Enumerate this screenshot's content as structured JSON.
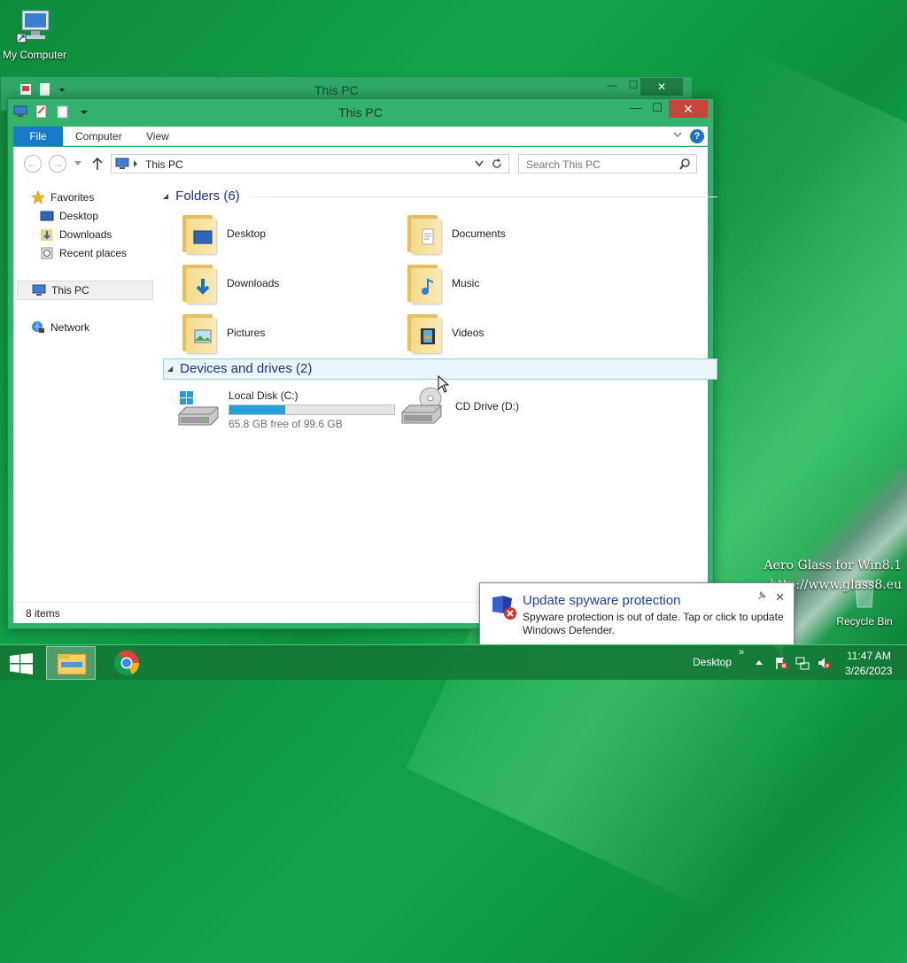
{
  "desktop": {
    "my_computer_label": "My Computer",
    "recycle_bin_label": "Recycle Bin",
    "watermark_line1": "Aero Glass for Win8.1",
    "watermark_line2": "http://www.glass8.eu"
  },
  "background_window": {
    "title": "This PC"
  },
  "window": {
    "title": "This PC",
    "controls": {
      "minimize": "—",
      "maximize": "☐",
      "close": "✕"
    },
    "ribbon_tabs": [
      "File",
      "Computer",
      "View"
    ],
    "help_glyph": "?",
    "address_path": "This PC",
    "search_placeholder": "Search This PC",
    "nav_pane": {
      "favorites_label": "Favorites",
      "favorites": [
        "Desktop",
        "Downloads",
        "Recent places"
      ],
      "this_pc_label": "This PC",
      "network_label": "Network"
    },
    "folders_header": "Folders (6)",
    "folders": [
      {
        "label": "Desktop",
        "icon": "desktop-folder-icon"
      },
      {
        "label": "Documents",
        "icon": "documents-folder-icon"
      },
      {
        "label": "Downloads",
        "icon": "downloads-folder-icon"
      },
      {
        "label": "Music",
        "icon": "music-folder-icon"
      },
      {
        "label": "Pictures",
        "icon": "pictures-folder-icon"
      },
      {
        "label": "Videos",
        "icon": "videos-folder-icon"
      }
    ],
    "devices_header": "Devices and drives (2)",
    "drives": {
      "local": {
        "label": "Local Disk (C:)",
        "free_text": "65.8 GB free of 99.6 GB",
        "used_fraction": 0.34
      },
      "cd": {
        "label": "CD Drive (D:)"
      }
    },
    "status_text": "8 items"
  },
  "notification": {
    "title": "Update spyware protection",
    "text": "Spyware protection is out of date. Tap or click to update Windows Defender.",
    "close_glyph": "✕"
  },
  "taskbar": {
    "desktop_label": "Desktop",
    "chevrons": "»",
    "time": "11:47 AM",
    "date": "3/26/2023"
  },
  "colors": {
    "accent": "#1979ca",
    "title_accent": "#1e3287",
    "close_red": "#c7463c",
    "drive_fill": "#26a0da"
  }
}
